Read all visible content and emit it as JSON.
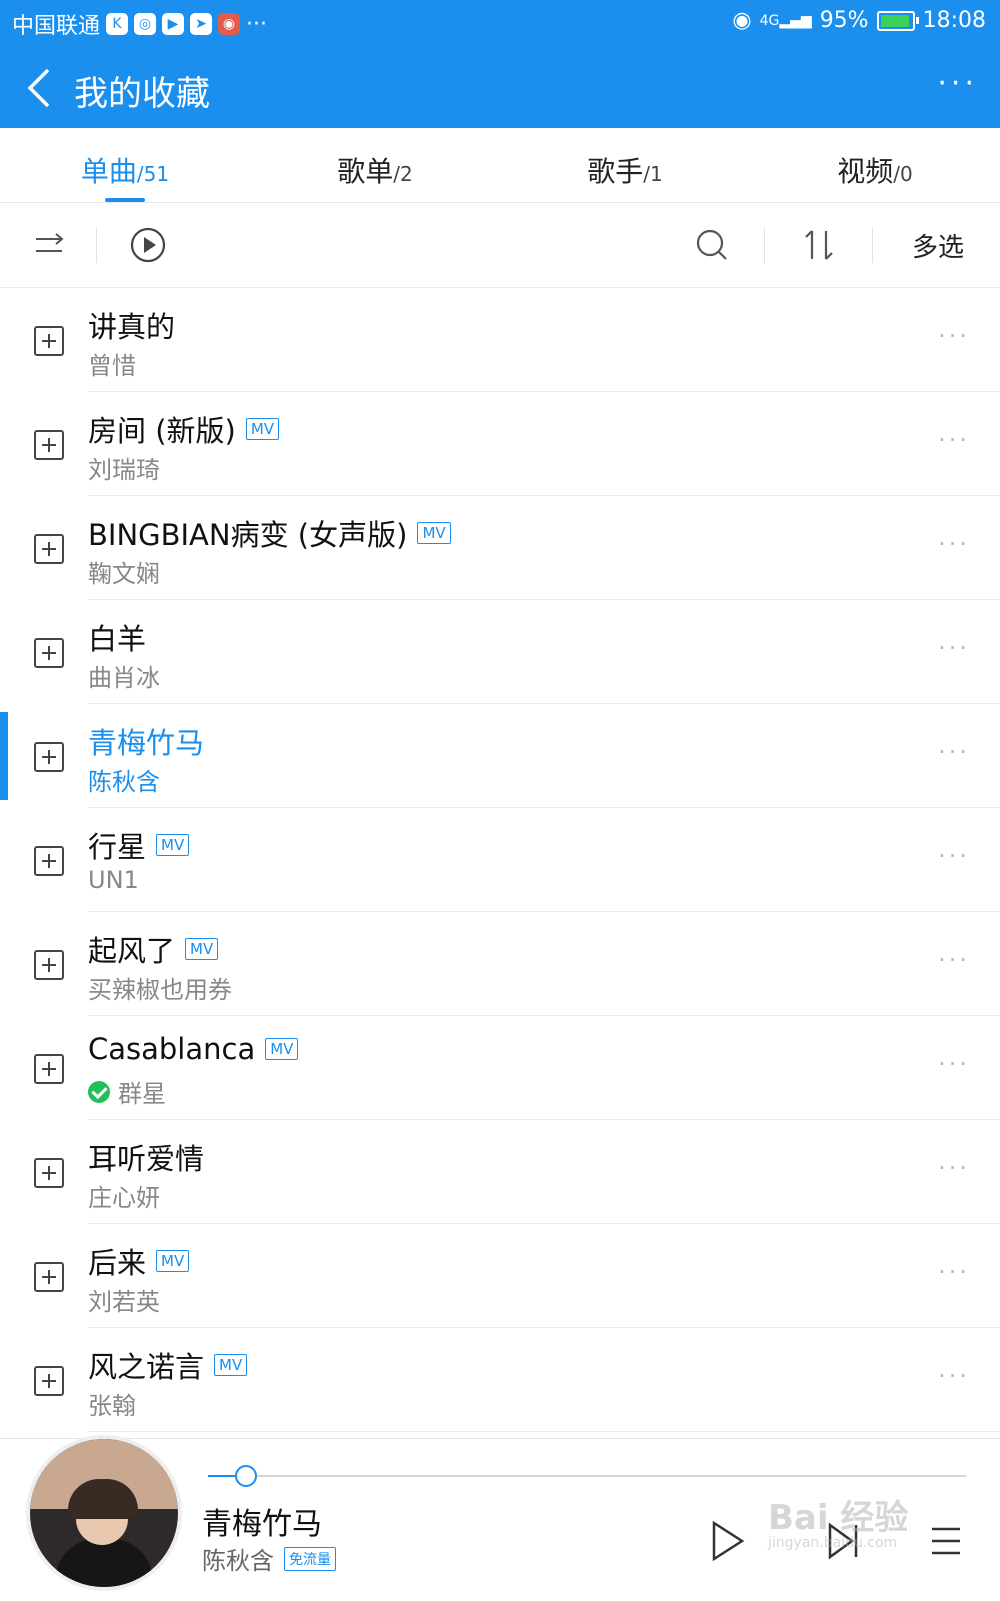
{
  "status_bar": {
    "carrier": "中国联通",
    "signal": "4G",
    "battery": "95%",
    "time": "18:08"
  },
  "header": {
    "title": "我的收藏",
    "more": "···"
  },
  "tabs": [
    {
      "label": "单曲",
      "count": "/51",
      "active": true
    },
    {
      "label": "歌单",
      "count": "/2",
      "active": false
    },
    {
      "label": "歌手",
      "count": "/1",
      "active": false
    },
    {
      "label": "视频",
      "count": "/0",
      "active": false
    }
  ],
  "toolbar": {
    "multi_select_label": "多选"
  },
  "mv_badge": "MV",
  "songs": [
    {
      "title": "讲真的",
      "artist": "曾惜",
      "mv": false,
      "playing": false
    },
    {
      "title": "房间 (新版)",
      "artist": "刘瑞琦",
      "mv": true,
      "playing": false
    },
    {
      "title": "BINGBIAN病变 (女声版)",
      "artist": "鞠文娴",
      "mv": true,
      "playing": false
    },
    {
      "title": "白羊",
      "artist": "曲肖冰",
      "mv": false,
      "playing": false
    },
    {
      "title": "青梅竹马",
      "artist": "陈秋含",
      "mv": false,
      "playing": true
    },
    {
      "title": "行星",
      "artist": "UN1",
      "mv": true,
      "playing": false
    },
    {
      "title": "起风了",
      "artist": "买辣椒也用券",
      "mv": true,
      "playing": false
    },
    {
      "title": "Casablanca",
      "artist": "群星",
      "mv": true,
      "playing": false,
      "verified": true
    },
    {
      "title": "耳听爱情",
      "artist": "庄心妍",
      "mv": false,
      "playing": false
    },
    {
      "title": "后来",
      "artist": "刘若英",
      "mv": true,
      "playing": false
    },
    {
      "title": "风之诺言",
      "artist": "张翰",
      "mv": true,
      "playing": false
    }
  ],
  "player": {
    "title": "青梅竹马",
    "artist": "陈秋含",
    "free_flow_badge": "免流量",
    "progress": 0.05
  },
  "watermark": {
    "text": "Bai 经验",
    "sub": "jingyan.baidu.com"
  },
  "colors": {
    "accent": "#1a8fee",
    "verified": "#22c05a"
  }
}
